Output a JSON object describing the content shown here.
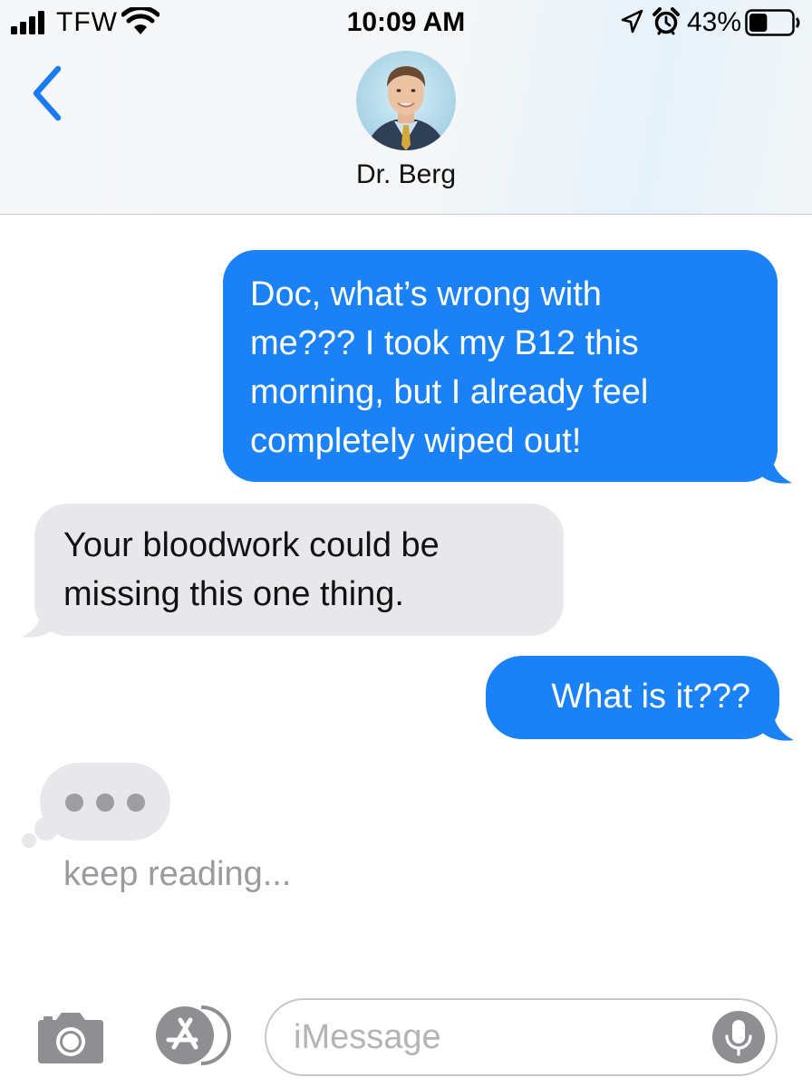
{
  "status_bar": {
    "carrier": "TFW",
    "time": "10:09 AM",
    "battery_percent": "43%",
    "battery_level": 0.43,
    "icons": [
      "signal-icon",
      "wifi-icon",
      "location-icon",
      "alarm-icon",
      "battery-icon"
    ]
  },
  "header": {
    "contact_name": "Dr. Berg",
    "back_icon": "chevron-left-icon"
  },
  "messages": [
    {
      "direction": "outgoing",
      "lines": [
        "Doc, what’s wrong with",
        "me??? I took my B12 this",
        "morning, but I already feel",
        "completely wiped out!"
      ]
    },
    {
      "direction": "incoming",
      "lines": [
        "Your bloodwork could be",
        "missing this one thing."
      ]
    },
    {
      "direction": "outgoing",
      "lines": [
        "What is it???"
      ]
    }
  ],
  "typing_indicator": {
    "caption": "keep reading..."
  },
  "input_bar": {
    "placeholder": "iMessage",
    "value": "",
    "icons": [
      "camera-icon",
      "app-store-icon",
      "microphone-icon"
    ]
  },
  "colors": {
    "outgoing_bubble": "#1a82f6",
    "incoming_bubble": "#e8e8ec",
    "accent": "#1a7cf5",
    "header_bg": "#f4f6f8"
  }
}
